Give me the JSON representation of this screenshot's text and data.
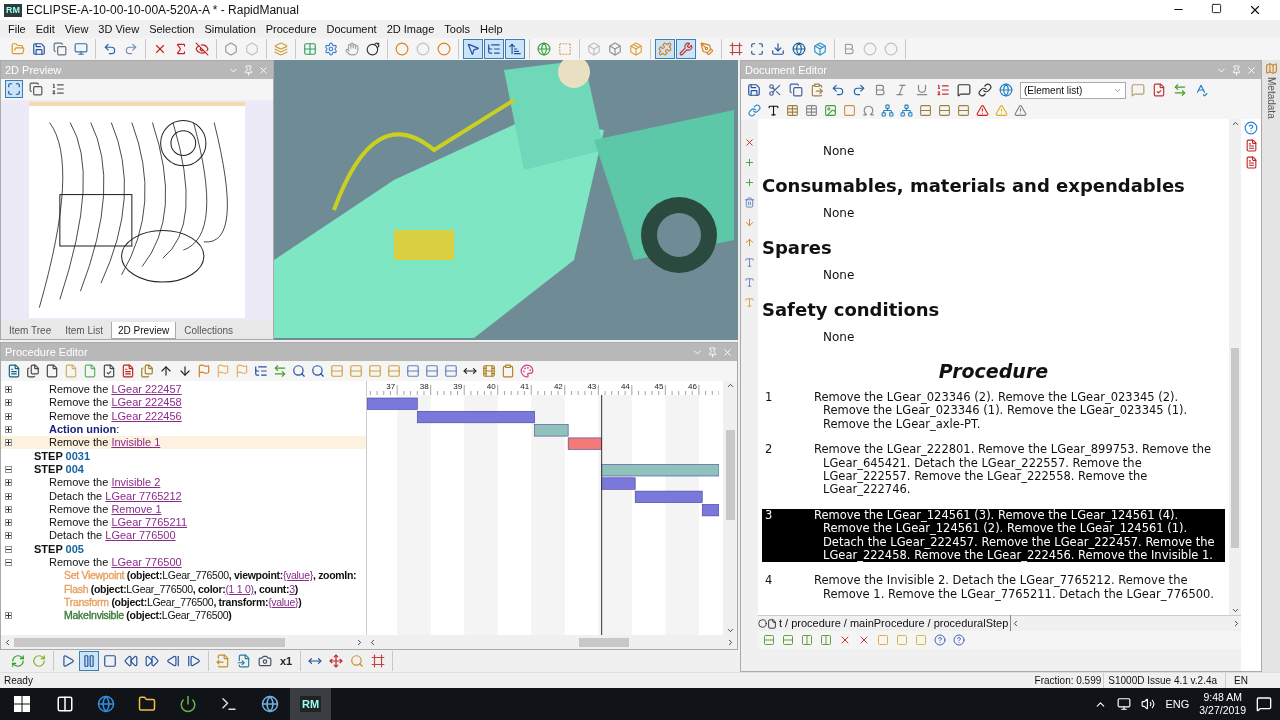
{
  "window": {
    "icon_label": "RM",
    "title": "ECLIPSE-A-10-00-10-00A-520A-A * - RapidManual"
  },
  "menu": [
    "File",
    "Edit",
    "View",
    "3D View",
    "Selection",
    "Simulation",
    "Procedure",
    "Document",
    "2D Image",
    "Tools",
    "Help"
  ],
  "toolbar": {
    "groups": [
      [
        {
          "kind": "open",
          "selected": false
        },
        {
          "kind": "save",
          "selected": false
        },
        {
          "kind": "copy",
          "selected": false
        },
        {
          "kind": "monitor",
          "selected": false
        }
      ],
      [
        {
          "kind": "undo",
          "selected": false
        },
        {
          "kind": "redo",
          "selected": false
        }
      ],
      [
        {
          "kind": "delete",
          "selected": false
        },
        {
          "kind": "delete-fx",
          "selected": false
        },
        {
          "kind": "hide",
          "selected": false
        }
      ],
      [
        {
          "kind": "hex",
          "selected": false
        },
        {
          "kind": "hex-off",
          "selected": false
        }
      ],
      [
        {
          "kind": "layers",
          "selected": false
        }
      ],
      [
        {
          "kind": "group",
          "selected": false
        },
        {
          "kind": "settings",
          "selected": false
        },
        {
          "kind": "hand",
          "selected": false
        },
        {
          "kind": "bomb",
          "selected": false
        }
      ],
      [
        {
          "kind": "circle",
          "selected": false
        },
        {
          "kind": "circle-off",
          "selected": false
        },
        {
          "kind": "circle",
          "selected": false
        }
      ],
      [
        {
          "kind": "pointer",
          "selected": true
        },
        {
          "kind": "tree",
          "selected": true
        },
        {
          "kind": "sort",
          "selected": true
        }
      ],
      [
        {
          "kind": "sphere",
          "selected": false
        },
        {
          "kind": "box-select",
          "selected": false
        }
      ],
      [
        {
          "kind": "cube-off",
          "selected": false
        },
        {
          "kind": "cube-wire",
          "selected": false
        },
        {
          "kind": "cube",
          "selected": false
        }
      ],
      [
        {
          "kind": "puzzle",
          "selected": true
        },
        {
          "kind": "wrench",
          "selected": true
        },
        {
          "kind": "tool",
          "selected": false
        }
      ],
      [
        {
          "kind": "frame",
          "selected": false
        },
        {
          "kind": "maximize",
          "selected": false
        },
        {
          "kind": "download",
          "selected": false
        },
        {
          "kind": "globe",
          "selected": false
        },
        {
          "kind": "package",
          "selected": false
        }
      ],
      [
        {
          "kind": "bold",
          "selected": false
        },
        {
          "kind": "circle-off",
          "selected": false
        },
        {
          "kind": "circle-off",
          "selected": false
        }
      ]
    ]
  },
  "preview": {
    "title": "2D Preview",
    "tabs": [
      {
        "label": "Item Tree",
        "selected": false
      },
      {
        "label": "Item List",
        "selected": false
      },
      {
        "label": "2D Preview",
        "selected": true
      },
      {
        "label": "Collections",
        "selected": false
      }
    ]
  },
  "procedure_editor": {
    "title": "Procedure Editor",
    "continued_items": [
      {
        "kind": "action",
        "verb": "Remove the",
        "target": "LGear 222457",
        "expanded": false,
        "highlighted": false
      },
      {
        "kind": "action",
        "verb": "Remove the",
        "target": "LGear 222458",
        "expanded": false,
        "highlighted": false
      },
      {
        "kind": "action",
        "verb": "Remove the",
        "target": "LGear 222456",
        "expanded": false,
        "highlighted": false
      },
      {
        "kind": "union",
        "label": "**Action union**:",
        "expanded": false,
        "highlighted": false
      },
      {
        "kind": "action",
        "verb": "Remove the",
        "target": "Invisible 1",
        "expanded": false,
        "highlighted": true
      }
    ],
    "steps": [
      {
        "kind": "step",
        "label": "STEP",
        "number": "0031",
        "highlighted": false
      },
      {
        "kind": "step",
        "label": "STEP",
        "number": "004",
        "expanded": true,
        "highlighted": false,
        "children": [
          {
            "kind": "action",
            "verb": "Remove the",
            "target": "Invisible 2",
            "expanded": false,
            "highlighted": false
          },
          {
            "kind": "action",
            "verb": "Detach the",
            "target": "LGear 7765212",
            "expanded": false,
            "highlighted": false
          },
          {
            "kind": "action",
            "verb": "Remove the",
            "target": "Remove 1",
            "expanded": false,
            "highlighted": false
          },
          {
            "kind": "action",
            "verb": "Remove the",
            "target": "LGear 7765211",
            "expanded": false,
            "highlighted": false
          },
          {
            "kind": "action",
            "verb": "Detach the",
            "target": "LGear 776500",
            "expanded": false,
            "highlighted": false
          }
        ]
      },
      {
        "kind": "step",
        "label": "STEP",
        "number": "005",
        "expanded": true,
        "highlighted": false,
        "children": [
          {
            "kind": "action",
            "verb": "Remove the",
            "target": "LGear 776500",
            "expanded": true,
            "highlighted": false,
            "children": [
              {
                "kind": "command",
                "name": "Set Viewpoint",
                "color": "#e8a060",
                "highlighted": false,
                "args": [
                  {
                    "kind": "key",
                    "text": "(object:"
                  },
                  {
                    "kind": "value",
                    "text": "LGear_776500"
                  },
                  {
                    "kind": "key",
                    "text": ", viewpoint:"
                  },
                  {
                    "kind": "reference",
                    "text": "{value}"
                  },
                  {
                    "kind": "key",
                    "text": ", zoomIn:"
                  }
                ]
              },
              {
                "kind": "command",
                "name": "Flash",
                "color": "#e8a060",
                "highlighted": false,
                "args": [
                  {
                    "kind": "key",
                    "text": "(object:"
                  },
                  {
                    "kind": "value",
                    "text": "LGear_776500"
                  },
                  {
                    "kind": "key",
                    "text": ", color:"
                  },
                  {
                    "kind": "reference",
                    "text": "(1 1 0)"
                  },
                  {
                    "kind": "key",
                    "text": ", count:"
                  },
                  {
                    "kind": "reference",
                    "text": "3"
                  },
                  {
                    "kind": "key",
                    "text": ")"
                  }
                ]
              },
              {
                "kind": "command",
                "name": "Transform",
                "color": "#e8a060",
                "highlighted": false,
                "args": [
                  {
                    "kind": "key",
                    "text": "(object:"
                  },
                  {
                    "kind": "value",
                    "text": "LGear_776500"
                  },
                  {
                    "kind": "key",
                    "text": ", transform:"
                  },
                  {
                    "kind": "reference",
                    "text": "{value}"
                  },
                  {
                    "kind": "key",
                    "text": ")"
                  }
                ]
              },
              {
                "kind": "command",
                "name": "MakeInvisible",
                "color": "#3a7a3a",
                "expanded": false,
                "highlighted": false,
                "args": [
                  {
                    "kind": "key",
                    "text": "(object:"
                  },
                  {
                    "kind": "value",
                    "text": "LGear_776500"
                  },
                  {
                    "kind": "key",
                    "text": ")"
                  }
                ]
              }
            ]
          }
        ]
      }
    ],
    "timeline_ticks": [
      "37",
      "38",
      "39",
      "40",
      "41",
      "42",
      "43",
      "44",
      "45",
      "46"
    ]
  },
  "playback": {
    "groups": [
      [
        {
          "kind": "refresh",
          "selected": false
        },
        {
          "kind": "refresh-alt",
          "selected": false
        }
      ],
      [
        {
          "kind": "play",
          "selected": false
        },
        {
          "kind": "pause",
          "selected": true
        },
        {
          "kind": "stop",
          "selected": false
        },
        {
          "kind": "rewind",
          "selected": false
        },
        {
          "kind": "forward",
          "selected": false
        },
        {
          "kind": "step-back",
          "selected": false
        },
        {
          "kind": "step-forward",
          "selected": false
        }
      ],
      [
        {
          "kind": "export",
          "selected": false
        },
        {
          "kind": "export-alt",
          "selected": false
        },
        {
          "kind": "camera",
          "selected": false
        },
        {
          "kind": "speed",
          "label": "x1",
          "selected": false
        }
      ],
      [
        {
          "kind": "resize",
          "selected": false
        },
        {
          "kind": "axes",
          "selected": false
        },
        {
          "kind": "zoom",
          "selected": false
        },
        {
          "kind": "frame",
          "selected": false
        }
      ]
    ]
  },
  "document_editor": {
    "title": "Document Editor",
    "element_list": "(Element list)",
    "sections": [
      {
        "kind": "para",
        "text": "None"
      },
      {
        "kind": "heading",
        "text": "Consumables, materials and expendables"
      },
      {
        "kind": "para",
        "text": "None"
      },
      {
        "kind": "heading",
        "text": "Spares"
      },
      {
        "kind": "para",
        "text": "None"
      },
      {
        "kind": "heading",
        "text": "Safety conditions"
      },
      {
        "kind": "para",
        "text": "None"
      },
      {
        "kind": "title",
        "text": "Procedure"
      }
    ],
    "steps": [
      {
        "number": "1",
        "text": "Remove the LGear_023346 (2). Remove the LGear_023345 (2). Remove the LGear_023346 (1). Remove the LGear_023345 (1). Remove the LGear_axle-PT.",
        "selected": false
      },
      {
        "number": "2",
        "text": "Remove the LGear_222801. Remove the LGear_899753. Remove the LGear_645421. Detach the LGear_222557. Remove the LGear_222557. Remove the LGear_222558. Remove the LGear_222746.",
        "selected": false
      },
      {
        "number": "3",
        "text": "Remove the LGear_124561 (3). Remove the LGear_124561 (4). Remove the LGear_124561 (2). Remove the LGear_124561 (1). Detach the LGear_222457. Remove the LGear_222457. Remove the LGear_222458. Remove the LGear_222456. Remove the Invisible 1.",
        "selected": true
      },
      {
        "number": "4",
        "text": "Remove the Invisible 2. Detach the LGear_7765212. Remove the Remove 1. Remove the LGear_7765211. Detach the LGear_776500.",
        "selected": false
      }
    ],
    "path": "t / procedure / mainProcedure / proceduralStep"
  },
  "metadata_tab": "Metadata",
  "status_bar": {
    "message": "Ready",
    "fraction": "Fraction: 0.599",
    "standard": "S1000D Issue 4.1 v.2.4a",
    "language": "EN"
  },
  "taskbar": {
    "apps": [
      {
        "kind": "task-view",
        "selected": false
      },
      {
        "kind": "browser",
        "selected": false
      },
      {
        "kind": "folder",
        "selected": false
      },
      {
        "kind": "power",
        "selected": false
      },
      {
        "kind": "terminal",
        "selected": false
      },
      {
        "kind": "globe",
        "selected": false
      },
      {
        "kind": "rm",
        "label": "RM",
        "selected": true
      }
    ],
    "language": "ENG",
    "time": "9:48 AM",
    "date": "3/27/2019"
  }
}
